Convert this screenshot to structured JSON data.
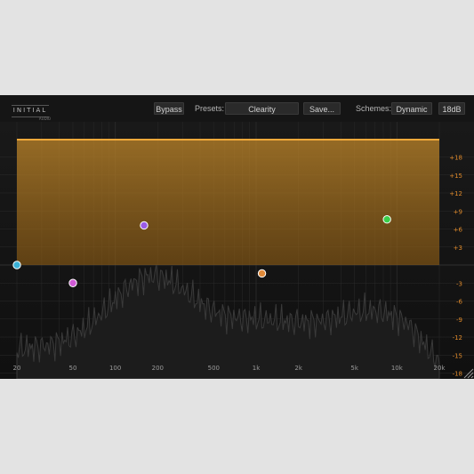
{
  "toolbar": {
    "logo": "INITIAL",
    "logo_sub": "AUDIO",
    "bypass_label": "Bypass",
    "presets_label": "Presets:",
    "preset_value": "Clearity",
    "save_label": "Save...",
    "schemes_label": "Schemes:",
    "scheme_value": "Dynamic",
    "range_label": "18dB"
  },
  "eq": {
    "db_ticks": [
      "+18",
      "+15",
      "+12",
      "+9",
      "+6",
      "+3",
      "-3",
      "-6",
      "-9",
      "-12",
      "-15",
      "-18"
    ],
    "freq_ticks": [
      "20",
      "50",
      "100",
      "200",
      "500",
      "1k",
      "2k",
      "5k",
      "10k",
      "20k"
    ],
    "colors": {
      "background": "#141414",
      "grid": "#2a2a2a",
      "db_label": "#e08a2a",
      "freq_label": "#9a9a9a",
      "curve": "#f2a93a",
      "fill": "#a8741e",
      "spectrum": "#3a3a3a"
    },
    "bands": [
      {
        "name": "low-cut",
        "color": "#3ab0d6",
        "freq": 20,
        "gain": 0
      },
      {
        "name": "low-shelf",
        "color": "#d05ad6",
        "freq": 50,
        "gain": -3
      },
      {
        "name": "bell-1",
        "color": "#9a5ae6",
        "freq": 160,
        "gain": 6.6
      },
      {
        "name": "bell-2",
        "color": "#e08a3a",
        "freq": 1100,
        "gain": -1.4
      },
      {
        "name": "high-bell",
        "color": "#3acf4a",
        "freq": 8500,
        "gain": 7.6
      }
    ]
  }
}
